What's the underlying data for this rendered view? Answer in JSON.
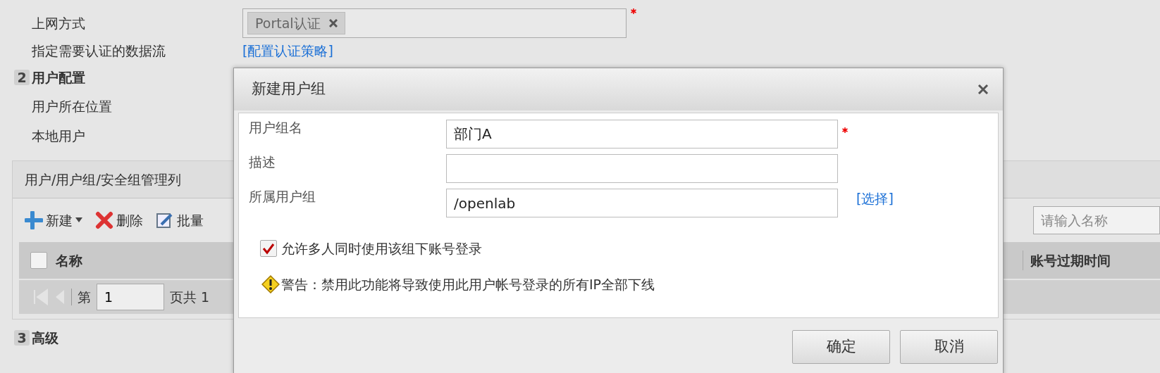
{
  "access": {
    "label": "上网方式",
    "tags": [
      {
        "text": "Portal认证"
      }
    ],
    "required": true
  },
  "auth_flow": {
    "label": "指定需要认证的数据流",
    "link": "[配置认证策略]"
  },
  "section_2": {
    "number": "2",
    "title": "用户配置"
  },
  "user_rows": [
    {
      "label": "用户所在位置"
    },
    {
      "label": "本地用户"
    }
  ],
  "panel": {
    "title": "用户/用户组/安全组管理列",
    "toolbar": [
      {
        "kind": "new",
        "label": "新建"
      },
      {
        "kind": "delete",
        "label": "删除"
      },
      {
        "kind": "edit",
        "label": "批量"
      }
    ],
    "search": {
      "placeholder": "请输入名称"
    },
    "select_all": false,
    "columns": [
      {
        "label": "名称"
      },
      {
        "label": "账号过期时间"
      }
    ],
    "pager": {
      "prefix": "第",
      "page": "1",
      "suffix": "页共 1"
    }
  },
  "section_3": {
    "number": "3",
    "title": "高级"
  },
  "dialog": {
    "title": "新建用户组",
    "fields": [
      {
        "label": "用户组名",
        "value": "部门A",
        "required": true
      },
      {
        "label": "描述",
        "required": false
      },
      {
        "label": "所属用户组",
        "value": "/openlab",
        "required": false,
        "link": "[选择]"
      }
    ],
    "allow_multi": {
      "label": "允许多人同时使用该组下账号登录",
      "checked": true
    },
    "warning": "警告：禁用此功能将导致使用此用户帐号登录的所有IP全部下线",
    "buttons": [
      {
        "label": "确定"
      },
      {
        "label": "取消"
      }
    ]
  }
}
